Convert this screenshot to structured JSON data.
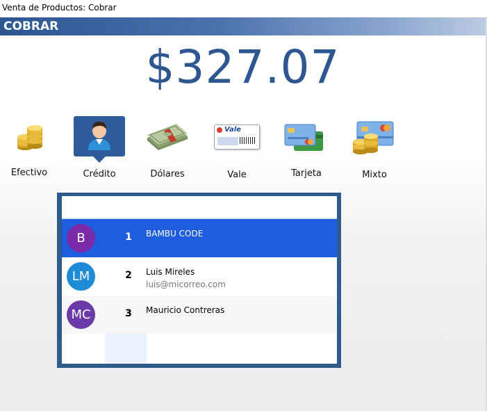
{
  "window": {
    "title": "Venta de Productos: Cobrar"
  },
  "header": {
    "title": "COBRAR"
  },
  "total": {
    "amount": "$327.07",
    "color": "#2e5792"
  },
  "payment_methods": [
    {
      "label": "Efectivo",
      "icon": "coins-icon",
      "selected": false
    },
    {
      "label": "Crédito",
      "icon": "user-icon",
      "selected": true
    },
    {
      "label": "Dólares",
      "icon": "money-stack-icon",
      "selected": false
    },
    {
      "label": "Vale",
      "icon": "voucher-icon",
      "selected": false,
      "icon_text": "Vale"
    },
    {
      "label": "Tarjeta",
      "icon": "credit-cards-icon",
      "selected": false
    },
    {
      "label": "Mixto",
      "icon": "coins-card-icon",
      "selected": false
    }
  ],
  "customers": {
    "rows": [
      {
        "initials": "B",
        "number": "1",
        "name": "BAMBU CODE",
        "email": "",
        "avatar_color": "#7b2aa8",
        "selected": true
      },
      {
        "initials": "LM",
        "number": "2",
        "name": "Luis Mireles",
        "email": "luis@micorreo.com",
        "avatar_color": "#1e8bd6",
        "selected": false
      },
      {
        "initials": "MC",
        "number": "3",
        "name": "Mauricio Contreras",
        "email": "",
        "avatar_color": "#6a3aa8",
        "selected": false
      }
    ],
    "selected_color": "#1e5ce0"
  }
}
